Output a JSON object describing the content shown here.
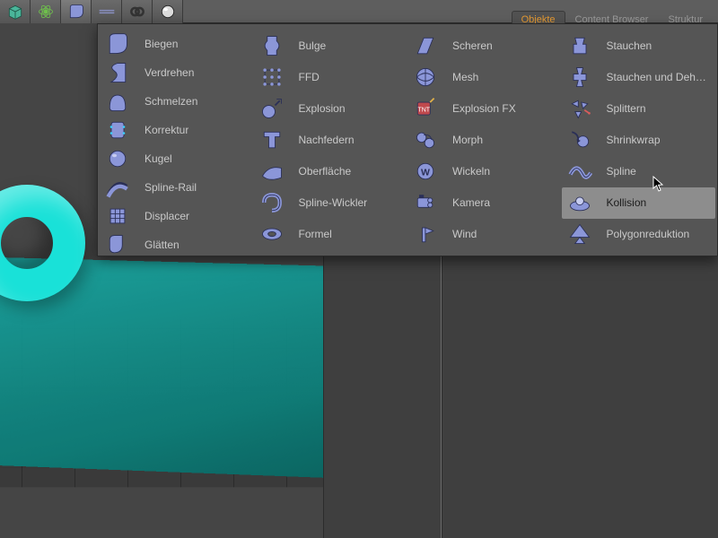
{
  "colors": {
    "icon_fill": "#8b96d8",
    "icon_stroke": "#2a2f57",
    "accent_tab": "#e59a33",
    "hover_bg": "#8d8d8d"
  },
  "tabs": [
    {
      "label": "Objekte",
      "active": true
    },
    {
      "label": "Content Browser",
      "active": false
    },
    {
      "label": "Struktur",
      "active": false
    }
  ],
  "toolbar": {
    "buttons": [
      {
        "name": "cube-primitive-icon",
        "active": false
      },
      {
        "name": "atom-generator-icon",
        "active": false
      },
      {
        "name": "deformers-icon",
        "active": true
      },
      {
        "name": "stripes-icon",
        "active": false
      },
      {
        "name": "link-rings-icon",
        "active": false
      },
      {
        "name": "sphere-icon",
        "active": false
      }
    ]
  },
  "dropdown": {
    "highlighted": "Kollision",
    "columns": [
      [
        {
          "name": "biegen",
          "label": "Biegen"
        },
        {
          "name": "verdrehen",
          "label": "Verdrehen"
        },
        {
          "name": "schmelzen",
          "label": "Schmelzen"
        },
        {
          "name": "korrektur",
          "label": "Korrektur"
        },
        {
          "name": "kugel",
          "label": "Kugel"
        },
        {
          "name": "spline-rail",
          "label": "Spline-Rail"
        },
        {
          "name": "displacer",
          "label": "Displacer"
        },
        {
          "name": "glaetten",
          "label": "Glätten"
        }
      ],
      [
        {
          "name": "bulge",
          "label": "Bulge"
        },
        {
          "name": "ffd",
          "label": "FFD"
        },
        {
          "name": "explosion",
          "label": "Explosion"
        },
        {
          "name": "nachfedern",
          "label": "Nachfedern"
        },
        {
          "name": "oberflaeche",
          "label": "Oberfläche"
        },
        {
          "name": "spline-wickler",
          "label": "Spline-Wickler"
        },
        {
          "name": "formel",
          "label": "Formel"
        }
      ],
      [
        {
          "name": "scheren",
          "label": "Scheren"
        },
        {
          "name": "mesh",
          "label": "Mesh"
        },
        {
          "name": "explosion-fx",
          "label": "Explosion FX"
        },
        {
          "name": "morph",
          "label": "Morph"
        },
        {
          "name": "wickeln",
          "label": "Wickeln"
        },
        {
          "name": "kamera",
          "label": "Kamera"
        },
        {
          "name": "wind",
          "label": "Wind"
        }
      ],
      [
        {
          "name": "stauchen",
          "label": "Stauchen"
        },
        {
          "name": "stauchen-und-dehnen",
          "label": "Stauchen und Dehnen"
        },
        {
          "name": "splittern",
          "label": "Splittern"
        },
        {
          "name": "shrinkwrap",
          "label": "Shrinkwrap"
        },
        {
          "name": "spline",
          "label": "Spline"
        },
        {
          "name": "kollision",
          "label": "Kollision"
        },
        {
          "name": "polygonreduktion",
          "label": "Polygonreduktion"
        }
      ]
    ]
  }
}
